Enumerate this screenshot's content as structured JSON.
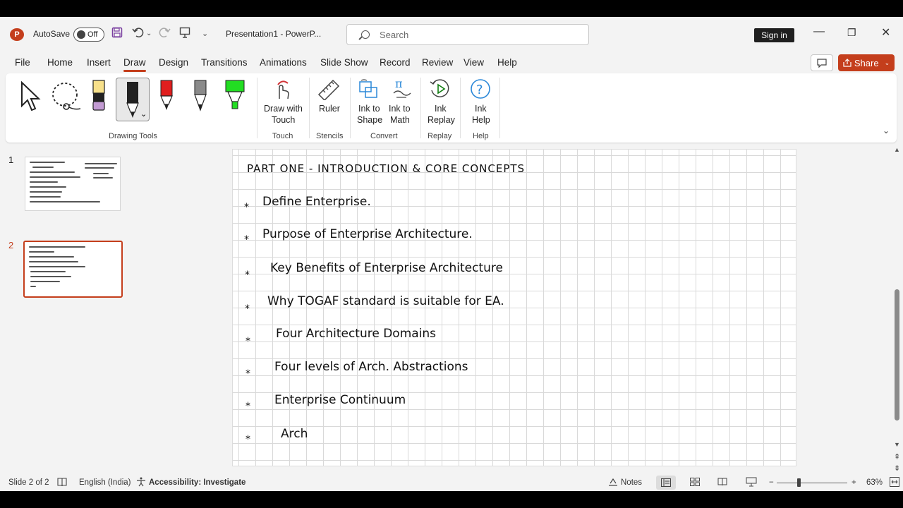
{
  "titlebar": {
    "autosave_label": "AutoSave",
    "autosave_state": "Off",
    "document_title": "Presentation1  -  PowerP...",
    "search_placeholder": "Search",
    "sign_in": "Sign in",
    "minimize": "—",
    "restore": "❐",
    "close": "✕"
  },
  "menu": {
    "items": [
      "File",
      "Home",
      "Insert",
      "Draw",
      "Design",
      "Transitions",
      "Animations",
      "Slide Show",
      "Record",
      "Review",
      "View",
      "Help"
    ],
    "active": "Draw",
    "share_label": "Share"
  },
  "ribbon": {
    "groups": {
      "drawing_tools": "Drawing Tools",
      "touch": "Touch",
      "stencils": "Stencils",
      "convert": "Convert",
      "replay": "Replay",
      "help": "Help"
    },
    "buttons": {
      "draw_with_touch": [
        "Draw with",
        "Touch"
      ],
      "ruler": "Ruler",
      "ink_to_shape": [
        "Ink to",
        "Shape"
      ],
      "ink_to_math": [
        "Ink to",
        "Math"
      ],
      "ink_replay": [
        "Ink",
        "Replay"
      ],
      "ink_help": [
        "Ink",
        "Help"
      ]
    },
    "pen_colors": {
      "highlighter_yellow": "#f7e08a",
      "highlighter_purple": "#c39bd3",
      "pen_black": "#222222",
      "pen_red": "#e01e1e",
      "pencil_gray": "#8a8a8a",
      "highlighter_green": "#22dd22"
    }
  },
  "thumbnails": {
    "numbers": [
      "1",
      "2"
    ],
    "selected": 2
  },
  "slide": {
    "heading": "PART ONE  -  INTRODUCTION  &  CORE  CONCEPTS",
    "bullet_symbol": "*",
    "items": [
      "Define  Enterprise.",
      "Purpose  of  Enterprise  Architecture.",
      "Key  Benefits  of  Enterprise  Architecture",
      "Why  TOGAF  standard  is  suitable  for  EA.",
      "Four  Architecture  Domains",
      "Four  levels  of  Arch.  Abstractions",
      "Enterprise  Continuum",
      "Arch"
    ]
  },
  "statusbar": {
    "slide_info": "Slide 2 of 2",
    "language": "English (India)",
    "accessibility": "Accessibility: Investigate",
    "notes": "Notes",
    "zoom_out": "−",
    "zoom_in": "+",
    "zoom_percent": "63%"
  },
  "colors": {
    "accent": "#c43e1c",
    "chrome": "#f3f3f3"
  }
}
